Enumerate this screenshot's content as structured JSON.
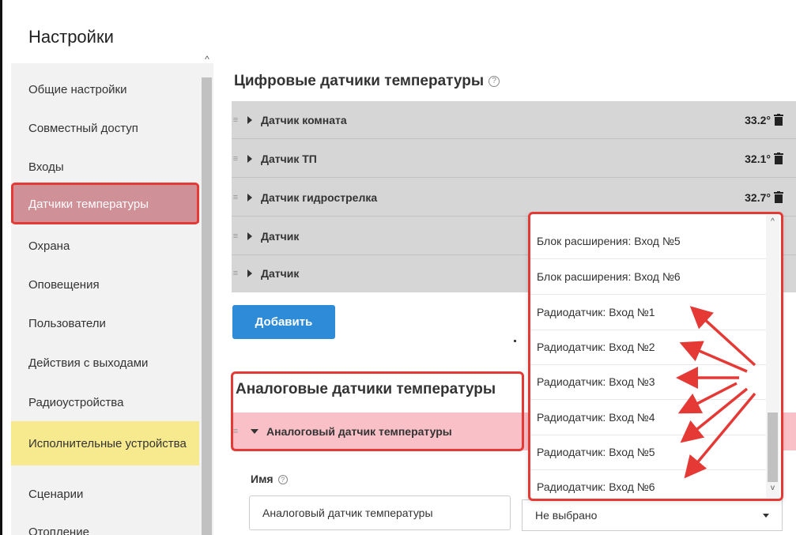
{
  "page": {
    "title": "Настройки"
  },
  "sidebar": {
    "items": [
      {
        "label": "Общие настройки"
      },
      {
        "label": "Совместный доступ"
      },
      {
        "label": "Входы"
      },
      {
        "label": "Датчики температуры",
        "active": true
      },
      {
        "label": "Охрана"
      },
      {
        "label": "Оповещения"
      },
      {
        "label": "Пользователи"
      },
      {
        "label": "Действия с выходами"
      },
      {
        "label": "Радиоустройства"
      },
      {
        "label": "Исполнительные устройства"
      },
      {
        "label": "Сценарии"
      },
      {
        "label": "Отопление"
      }
    ]
  },
  "digital": {
    "title": "Цифровые датчики температуры",
    "help_icon": "?",
    "sensors": [
      {
        "name": "Датчик комната",
        "temp": "33.2°"
      },
      {
        "name": "Датчик ТП",
        "temp": "32.1°"
      },
      {
        "name": "Датчик гидрострелка",
        "temp": "32.7°"
      },
      {
        "name": "Датчик",
        "temp": ""
      },
      {
        "name": "Датчик",
        "temp": ""
      }
    ],
    "add_button": "Добавить"
  },
  "analog": {
    "title": "Аналоговые датчики температуры",
    "sensor_name": "Аналоговый датчик температуры",
    "name_label": "Имя",
    "name_value": "Аналоговый датчик температуры",
    "select_value": "Не выбрано"
  },
  "dropdown": {
    "options": [
      "Блок расширения: Вход №5",
      "Блок расширения: Вход №6",
      "Радиодатчик: Вход №1",
      "Радиодатчик: Вход №2",
      "Радиодатчик: Вход №3",
      "Радиодатчик: Вход №4",
      "Радиодатчик: Вход №5",
      "Радиодатчик: Вход №6"
    ]
  },
  "colors": {
    "accent_blue": "#2d8bd8",
    "annotation_red": "#e53935",
    "active_nav": "#cf9097",
    "highlight_yellow": "#f7e98e",
    "analog_row_pink": "#f9c0c8"
  }
}
